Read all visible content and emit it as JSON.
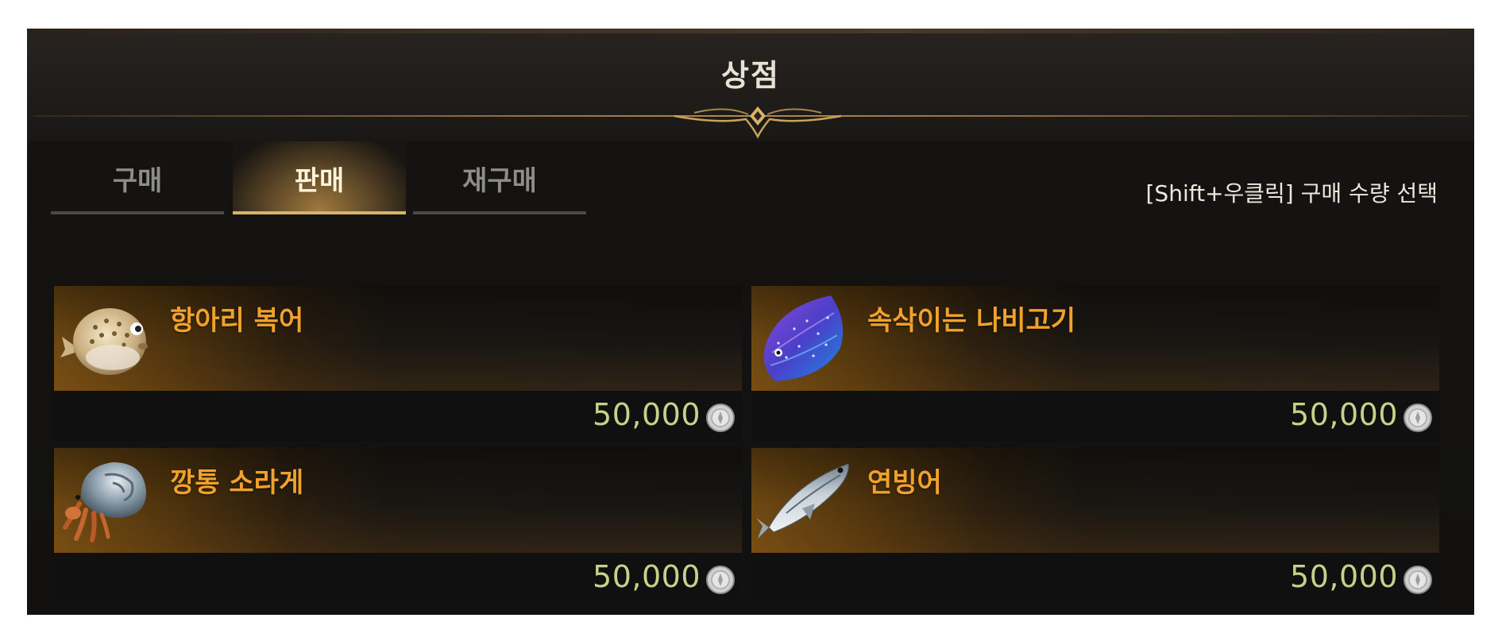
{
  "window": {
    "title": "상점"
  },
  "tabs": [
    {
      "label": "구매",
      "active": false
    },
    {
      "label": "판매",
      "active": true
    },
    {
      "label": "재구매",
      "active": false
    }
  ],
  "hint": "[Shift+우클릭] 구매 수량 선택",
  "items": [
    {
      "name": "항아리 복어",
      "price": "50,000",
      "icon": "pufferfish-icon"
    },
    {
      "name": "속삭이는 나비고기",
      "price": "50,000",
      "icon": "butterflyfish-icon"
    },
    {
      "name": "깡통 소라게",
      "price": "50,000",
      "icon": "hermit-crab-icon"
    },
    {
      "name": "연빙어",
      "price": "50,000",
      "icon": "smelt-fish-icon"
    }
  ],
  "colors": {
    "item_name": "#f0a22a",
    "price": "#c8d08a",
    "active_tab_underline": "#d7b36a"
  },
  "currency_icon": "silver-coin-icon"
}
